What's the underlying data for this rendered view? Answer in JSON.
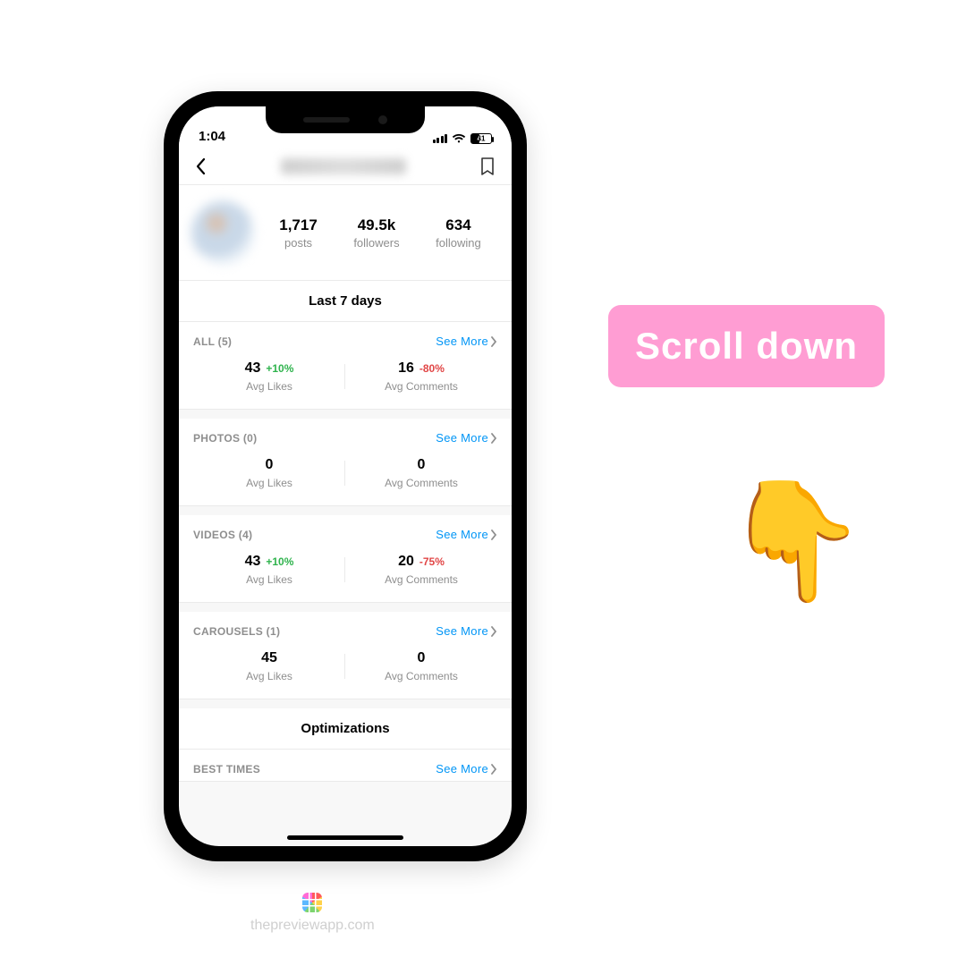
{
  "statusbar": {
    "time": "1:04",
    "battery_pct": "41"
  },
  "profile": {
    "posts_value": "1,717",
    "posts_label": "posts",
    "followers_value": "49.5k",
    "followers_label": "followers",
    "following_value": "634",
    "following_label": "following"
  },
  "period_title": "Last 7 days",
  "see_more_label": "See More",
  "avg_likes_label": "Avg Likes",
  "avg_comments_label": "Avg Comments",
  "cards": {
    "all": {
      "title": "ALL (5)",
      "likes": "43",
      "likes_delta": "+10%",
      "comments": "16",
      "comments_delta": "-80%"
    },
    "photos": {
      "title": "PHOTOS (0)",
      "likes": "0",
      "likes_delta": "",
      "comments": "0",
      "comments_delta": ""
    },
    "videos": {
      "title": "VIDEOS (4)",
      "likes": "43",
      "likes_delta": "+10%",
      "comments": "20",
      "comments_delta": "-75%"
    },
    "carousels": {
      "title": "CAROUSELS (1)",
      "likes": "45",
      "likes_delta": "",
      "comments": "0",
      "comments_delta": ""
    }
  },
  "optimizations_title": "Optimizations",
  "best_times_title": "BEST TIMES",
  "callout_text": "Scroll down",
  "pointer_emoji": "👇",
  "footer_text": "thepreviewapp.com"
}
